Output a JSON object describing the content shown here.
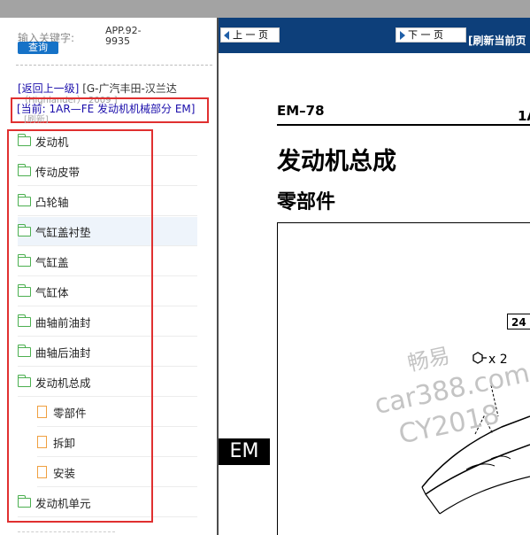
{
  "sidebar": {
    "search_label": "输入关键字:",
    "search_code": "APP.92-9935",
    "query_button": "查询",
    "nav_parent_link": "[返回上一级]",
    "nav_parent_text": "[G-广汽丰田-汉兰达",
    "nav_parent_line2": "（Highlander） 2009 ]",
    "nav_current": "[当前: 1AR—FE 发动机机械部分 EM]",
    "nav_refresh": "[刷新]",
    "tree": [
      {
        "label": "发动机",
        "type": "folder"
      },
      {
        "label": "传动皮带",
        "type": "folder"
      },
      {
        "label": "凸轮轴",
        "type": "folder"
      },
      {
        "label": "气缸盖衬垫",
        "type": "folder"
      },
      {
        "label": "气缸盖",
        "type": "folder"
      },
      {
        "label": "气缸体",
        "type": "folder"
      },
      {
        "label": "曲轴前油封",
        "type": "folder"
      },
      {
        "label": "曲轴后油封",
        "type": "folder"
      },
      {
        "label": "发动机总成",
        "type": "folder-open"
      },
      {
        "label": "零部件",
        "type": "file"
      },
      {
        "label": "拆卸",
        "type": "file"
      },
      {
        "label": "安装",
        "type": "file"
      },
      {
        "label": "发动机单元",
        "type": "folder"
      }
    ]
  },
  "toolbar": {
    "prev_label": "上 一 页",
    "next_label": "下 一 页",
    "refresh_label": "[刷新当前页"
  },
  "document": {
    "page_number": "EM–78",
    "page_number_right": "1A",
    "title": "发动机总成",
    "subtitle": "零部件",
    "section_tab": "EM",
    "badge": "24 (",
    "qty": "x 2",
    "watermark_1": "畅易",
    "watermark_2": "car388.com",
    "watermark_3": "CY2018"
  },
  "colors": {
    "toolbar_bg": "#0d3f7a",
    "highlight_box": "#e03030",
    "query_button": "#1672c7",
    "folder_icon": "#4caf50",
    "file_icon": "#f0a040"
  }
}
